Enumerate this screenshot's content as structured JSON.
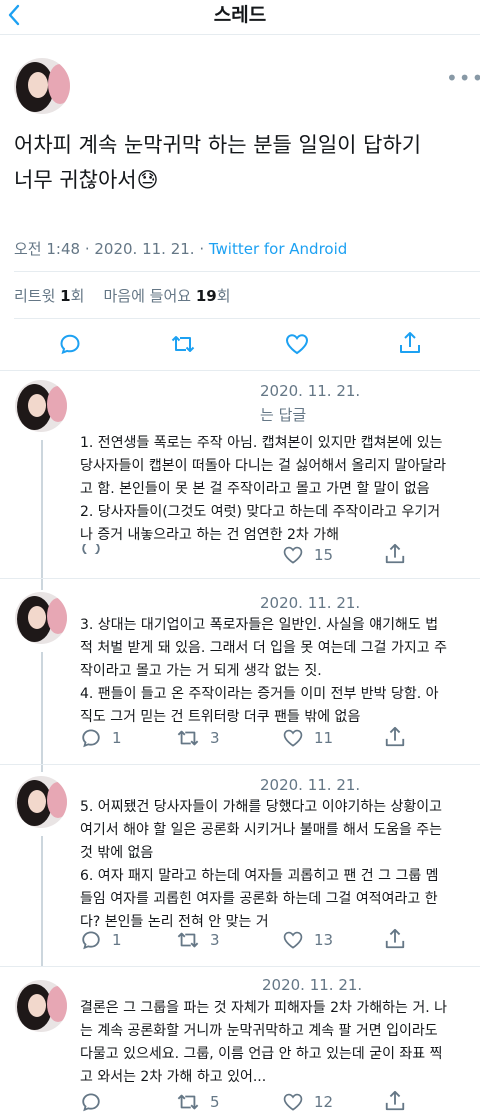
{
  "header": {
    "back_label": "<",
    "title": "스레드"
  },
  "main_tweet": {
    "text_line1": "어차피 계속 눈막귀막 하는 분들 일일이 답하기",
    "text_line2": "너무 귀찮아서",
    "emoji": "😓",
    "time": "오전 1:48 · 2020. 11. 21. · ",
    "client": "Twitter for Android",
    "retweets_label": "리트윗 ",
    "retweets": "1",
    "retweets_unit": "회",
    "likes_label": "마음에 들어요 ",
    "likes": "19",
    "likes_unit": "회"
  },
  "replies": [
    {
      "date": "2020. 11. 21.",
      "sub": "는 답글",
      "lines": [
        "1. 전연생들 폭로는 주작 아님. 캡쳐본이 있지만 캡쳐본에 있는",
        "당사자들이 캡본이 떠돌아 다니는 걸 싫어해서 올리지 말아달라",
        "고 함. 본인들이 못 본 걸 주작이라고 몰고 가면 할 말이 없음",
        "2. 당사자들이(그것도 여럿) 맞다고 하는데 주작이라고 우기거",
        "나 증거 내놓으라고 하는 건 엄연한 2차 가해"
      ],
      "likes": "15"
    },
    {
      "date": "2020. 11. 21.",
      "lines": [
        "3. 상대는 대기업이고 폭로자들은 일반인. 사실을 얘기해도 법",
        "적 처벌 받게 돼 있음. 그래서 더 입을 못 여는데 그걸 가지고 주",
        "작이라고 몰고 가는 거 되게 생각 없는 짓.",
        "4. 팬들이 들고 온 주작이라는 증거들 이미 전부 반박 당함. 아",
        "직도 그거 믿는 건 트위터랑 더쿠 팬들 밖에 없음"
      ],
      "replies": "1",
      "retweets": "3",
      "likes": "11"
    },
    {
      "date": "2020. 11. 21.",
      "lines": [
        "5. 어찌됐건 당사자들이 가해를 당했다고 이야기하는 상황이고",
        "여기서 해야 할 일은 공론화 시키거나 불매를 해서 도움을 주는",
        "것 밖에 없음",
        "6. 여자 패지 말라고 하는데 여자들 괴롭히고 팬 건 그 그룹 멤",
        "들임 여자를 괴롭힌 여자를 공론화 하는데 그걸 여적여라고 한",
        "다? 본인들 논리 전혀 안 맞는 거"
      ],
      "replies": "1",
      "retweets": "3",
      "likes": "13"
    },
    {
      "date": "2020. 11. 21.",
      "lines": [
        "결론은 그 그룹을 파는 것 자체가 피해자들 2차 가해하는 거. 나",
        "는 계속 공론화할 거니까 눈막귀막하고 계속 팔 거면 입이라도",
        "다물고 있으세요. 그룹, 이름 언급 안 하고 있는데 굳이 좌표 찍",
        "고 와서는 2차 가해 하고 있어..."
      ],
      "retweets": "5",
      "likes": "12"
    }
  ],
  "icons": {
    "reply": "speech-bubble-icon",
    "retweet": "retweet-arrows-icon",
    "like": "heart-icon",
    "share": "share-upload-icon",
    "more": "more-dots-icon"
  },
  "colors": {
    "accent": "#1da1f2",
    "secondary_text": "#657786",
    "divider": "#e6ecf0"
  }
}
